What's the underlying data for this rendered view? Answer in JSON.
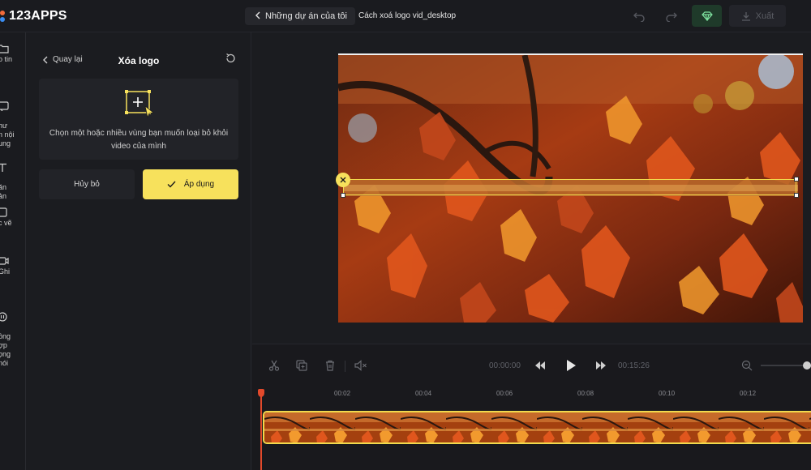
{
  "app": {
    "brand": "123APPS"
  },
  "topbar": {
    "back_label": "Những dự án của tôi",
    "project_name": "Cách xoá logo vid_desktop",
    "export_label": "Xuất",
    "icons": [
      "undo-icon",
      "redo-icon",
      "diamond-icon",
      "download-icon"
    ]
  },
  "sidebar": {
    "items": [
      {
        "label": "o tin",
        "icon": "folder-icon"
      },
      {
        "label": "hư\nn nội\nung",
        "icon": "subtitle-icon"
      },
      {
        "label": "ăn\nản",
        "icon": "text-icon"
      },
      {
        "label": "c vẽ",
        "icon": "drawing-icon"
      },
      {
        "label": "Ghi",
        "icon": "record-icon"
      },
      {
        "label": "ồng\nợp\nọng\nnói",
        "icon": "voice-icon"
      }
    ]
  },
  "panel": {
    "back_label": "Quay lại",
    "title": "Xóa logo",
    "hint": "Chọn một hoặc nhiều vùng bạn muốn loại bỏ khỏi video của mình",
    "cancel_label": "Hủy bỏ",
    "apply_label": "Áp dụng"
  },
  "timeline": {
    "current_time": "00:00:00",
    "total_time": "00:15:26",
    "ruler": [
      "00:02",
      "00:04",
      "00:06",
      "00:08",
      "00:10",
      "00:12"
    ]
  },
  "colors": {
    "accent": "#f7e15c",
    "premium": "#7fe3a0",
    "playhead": "#e2492b",
    "background": "#1b1c20"
  }
}
